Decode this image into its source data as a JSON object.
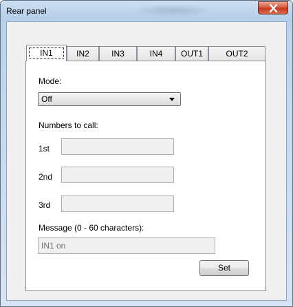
{
  "window": {
    "title": "Rear panel"
  },
  "tabs": [
    {
      "label": "IN1",
      "active": true
    },
    {
      "label": "IN2",
      "active": false
    },
    {
      "label": "IN3",
      "active": false
    },
    {
      "label": "IN4",
      "active": false
    },
    {
      "label": "OUT1",
      "active": false
    },
    {
      "label": "OUT2",
      "active": false
    }
  ],
  "form": {
    "mode_label": "Mode:",
    "mode_value": "Off",
    "numbers_label": "Numbers to call:",
    "first_label": "1st",
    "first_value": "",
    "second_label": "2nd",
    "second_value": "",
    "third_label": "3rd",
    "third_value": "",
    "message_label": "Message (0 - 60 characters):",
    "message_value": "IN1 on",
    "set_label": "Set"
  },
  "colors": {
    "close_button": "#c7391f",
    "title_bar": "#bcd3ec",
    "client_bg": "#f0f0f0",
    "disabled_field_bg": "#f0f0f0"
  }
}
